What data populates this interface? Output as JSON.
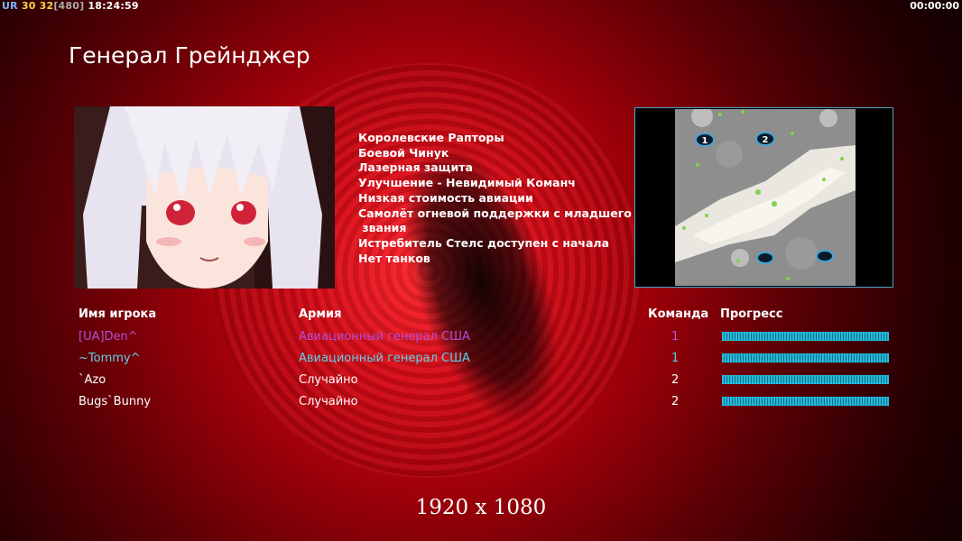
{
  "hud": {
    "ur_label": "UR",
    "fps": "30",
    "fps2": "32",
    "cap": "[480]",
    "clock": "18:24:59",
    "timer": "00:00:00"
  },
  "general_title": "Генерал Грейнджер",
  "features": [
    "Королевские Рапторы",
    "Боевой Чинук",
    "Лазерная защита",
    "Улучшение - Невидимый Команч",
    "Низкая стоимость авиации",
    "Самолёт огневой поддержки с младшего",
    " звания",
    "Истребитель Стелс доступен с начала",
    "Нет танков"
  ],
  "minimap": {
    "start_1": "1",
    "start_2": "2"
  },
  "table": {
    "headers": {
      "player": "Имя игрока",
      "army": "Армия",
      "team": "Команда",
      "progress": "Прогресс"
    },
    "rows": [
      {
        "name": "[UA]Den^",
        "army": "Авиационный генерал США",
        "team": "1",
        "color": "#b34fd8",
        "progress": 1.0
      },
      {
        "name": "~Tommy^",
        "army": "Авиационный генерал США",
        "team": "1",
        "color": "#5fd0e8",
        "progress": 1.0
      },
      {
        "name": "`Azo",
        "army": "Случайно",
        "team": "2",
        "color": "#ffffff",
        "progress": 1.0
      },
      {
        "name": "Bugs`Bunny",
        "army": "Случайно",
        "team": "2",
        "color": "#ffffff",
        "progress": 1.0
      }
    ]
  },
  "resolution": "1920 x 1080"
}
